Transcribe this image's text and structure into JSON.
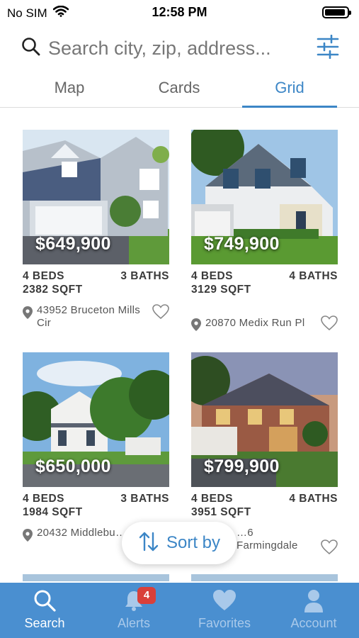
{
  "status_bar": {
    "carrier": "No SIM",
    "time": "12:58 PM",
    "battery_level": 0.92
  },
  "search": {
    "placeholder": "Search city, zip, address..."
  },
  "tabs": [
    {
      "label": "Map",
      "active": false
    },
    {
      "label": "Cards",
      "active": false
    },
    {
      "label": "Grid",
      "active": true
    }
  ],
  "listings": [
    {
      "price": "$649,900",
      "beds": "4 BEDS",
      "baths": "3 BATHS",
      "sqft": "2382 SQFT",
      "address": "43952 Bruceton Mills Cir"
    },
    {
      "price": "$749,900",
      "beds": "4 BEDS",
      "baths": "4 BATHS",
      "sqft": "3129 SQFT",
      "address": "20870 Medix Run Pl"
    },
    {
      "price": "$650,000",
      "beds": "4 BEDS",
      "baths": "3 BATHS",
      "sqft": "1984 SQFT",
      "address": "20432 Middlebu… St"
    },
    {
      "price": "$799,900",
      "beds": "4 BEDS",
      "baths": "4 BATHS",
      "sqft": "3951 SQFT",
      "address": "…6 Farmingdale"
    }
  ],
  "sort": {
    "label": "Sort by"
  },
  "tab_bar": [
    {
      "label": "Search",
      "icon": "search-icon",
      "active": true
    },
    {
      "label": "Alerts",
      "icon": "bell-icon",
      "badge": "4",
      "active": false
    },
    {
      "label": "Favorites",
      "icon": "heart-icon",
      "active": false
    },
    {
      "label": "Account",
      "icon": "person-icon",
      "active": false
    }
  ],
  "colors": {
    "accent": "#3c86c6",
    "tab_bar_bg": "#4a8fd0",
    "badge": "#d9403a"
  }
}
